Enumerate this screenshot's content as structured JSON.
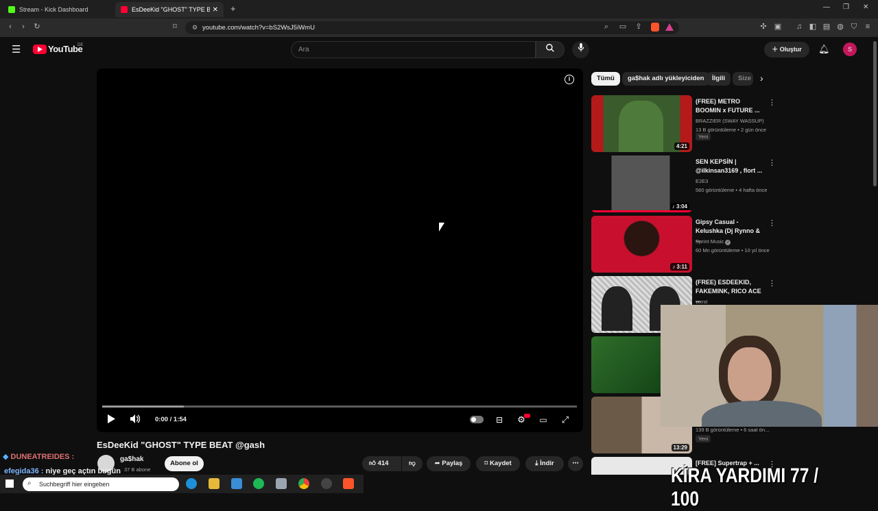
{
  "browser": {
    "tabs": [
      {
        "label": "Stream - Kick Dashboard",
        "favicon_color": "#53fc18"
      },
      {
        "label": "EsDeeKid \"GHOST\" TYPE BEAT @",
        "favicon_color": "#ff0033"
      }
    ],
    "url": "youtube.com/watch?v=bS2WsJ5iWmU"
  },
  "yt": {
    "logo": "YouTube",
    "region": "DE",
    "search_placeholder": "Ara",
    "create_label": "Oluştur",
    "avatar_letter": "S"
  },
  "player": {
    "time": "0:00 / 1:54",
    "progress_buffered_fraction": 0.17
  },
  "video": {
    "title": "EsDeeKid \"GHOST\" TYPE BEAT @gash",
    "channel": "ga$hak",
    "subscribers": "37 B abone",
    "subscribe_label": "Abone ol",
    "likes": "414",
    "share_label": "Paylaş",
    "save_label": "Kaydet",
    "download_label": "İndir"
  },
  "chips": [
    "Tümü",
    "ga$hak adlı yükleyiciden",
    "İlgili",
    "Size"
  ],
  "recommendations": [
    {
      "title": "(FREE) METRO BOOMIN x FUTURE ...",
      "channel": "BRAZZIER (SWAY WASSUP)",
      "meta": "13 B görüntüleme • 2 gün önce",
      "badge": "Yeni",
      "duration": "4:21"
    },
    {
      "title": "SEN KEPSİN | @ilkinsan3169 , flort ...",
      "channel": "E2E3",
      "meta": "560 görüntüleme • 4 hafta önce",
      "badge": "",
      "duration": "♪ 3:04"
    },
    {
      "title": "Gipsy Casual - Kelushka (Dj Rynno & ...",
      "channel": "Sprint Music",
      "meta": "60 Mn görüntüleme • 10 yıl önce",
      "badge": "",
      "duration": "♪ 3:11"
    },
    {
      "title": "(FREE) ESDEEKID, FAKEMINK, RICO ACE ...",
      "channel": "wxrst",
      "meta": "",
      "badge": "",
      "duration": ""
    },
    {
      "title": "",
      "channel": "",
      "meta": "",
      "badge": "",
      "duration": ""
    },
    {
      "title": "",
      "channel": "",
      "meta": "139 B görüntüleme • 6 saat ön...",
      "badge": "Yeni",
      "duration": "13:29"
    },
    {
      "title": "[FREE] Supertrap + ...",
      "channel": "",
      "meta": "",
      "badge": "",
      "duration": ""
    }
  ],
  "overlay": {
    "chat1_user": "DUNEATREIDES :",
    "chat2_user": "efegida36 :",
    "chat2_msg": "niye geç açtın bugün",
    "counter": "KİRA YARDIMI 77 / 100",
    "taskbar_search": "Suchbegriff hier eingeben"
  },
  "colors": {
    "accent_red": "#ff0033",
    "kick_green": "#53fc18"
  }
}
